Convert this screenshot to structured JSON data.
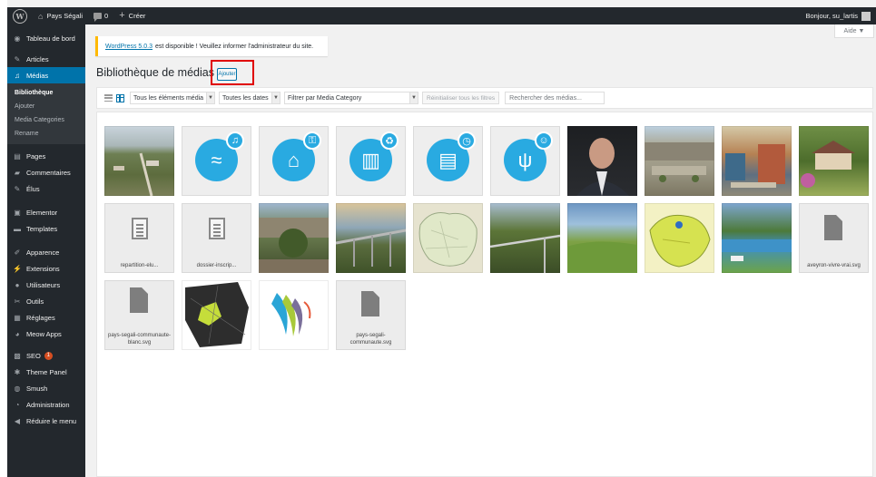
{
  "adminbar": {
    "site_name": "Pays Ségali",
    "comments_count": "0",
    "new_label": "Créer",
    "greeting": "Bonjour, su_lartis"
  },
  "sidebar": {
    "items": [
      {
        "label": "Tableau de bord",
        "icon": "dashboard-icon"
      },
      {
        "label": "Articles",
        "icon": "pin-icon"
      },
      {
        "label": "Médias",
        "icon": "media-icon"
      },
      {
        "label": "Pages",
        "icon": "page-icon"
      },
      {
        "label": "Commentaires",
        "icon": "comment-icon"
      },
      {
        "label": "Élus",
        "icon": "pin-icon"
      },
      {
        "label": "Elementor",
        "icon": "elementor-icon"
      },
      {
        "label": "Templates",
        "icon": "folder-icon"
      },
      {
        "label": "Apparence",
        "icon": "brush-icon"
      },
      {
        "label": "Extensions",
        "icon": "plugin-icon"
      },
      {
        "label": "Utilisateurs",
        "icon": "user-icon"
      },
      {
        "label": "Outils",
        "icon": "wrench-icon"
      },
      {
        "label": "Réglages",
        "icon": "settings-icon"
      },
      {
        "label": "Meow Apps",
        "icon": "meow-icon"
      },
      {
        "label": "SEO",
        "icon": "seo-icon",
        "badge": "1"
      },
      {
        "label": "Theme Panel",
        "icon": "gear-icon"
      },
      {
        "label": "Smush",
        "icon": "smush-icon"
      },
      {
        "label": "Administration",
        "icon": "admin-icon"
      },
      {
        "label": "Réduire le menu",
        "icon": "collapse-icon"
      }
    ],
    "submenu": [
      "Bibliothèque",
      "Ajouter",
      "Media Categories",
      "Rename"
    ]
  },
  "help_tab": "Aide ▼",
  "notice": {
    "link": "WordPress 5.0.3",
    "text": "est disponible ! Veuillez informer l'administrateur du site."
  },
  "page": {
    "title": "Bibliothèque de médias",
    "add_button": "Ajouter"
  },
  "toolbar": {
    "filter_type": "Tous les éléments média",
    "filter_date": "Toutes les dates",
    "filter_category": "Filtrer par Media Category",
    "reset_button": "Réinitialiser tous les filtres",
    "search_placeholder": "Rechercher des médias..."
  },
  "files": {
    "f1": "repartition-elu...",
    "f2": "dossier-inscrip...",
    "f3": "aveyron-vivre-vrai.svg",
    "f4": "pays-segali-communaute-blanc.svg",
    "f5": "pays-segali-communaute.svg"
  },
  "colors": {
    "admin_dark": "#23282d",
    "wp_blue": "#0073aa",
    "icon_blue": "#29aae1",
    "notice_yellow": "#ffb900",
    "highlight_red": "#e00000"
  }
}
